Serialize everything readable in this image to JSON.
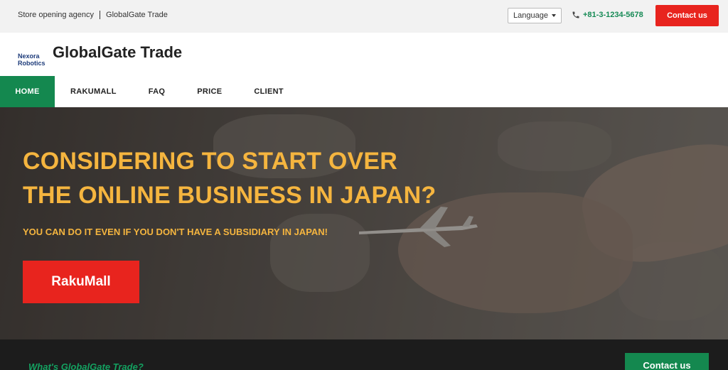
{
  "topbar": {
    "tagline_left": "Store opening agency",
    "tagline_right": "GlobalGate Trade",
    "language_label": "Language",
    "phone": "+81-3-1234-5678",
    "contact_label": "Contact us"
  },
  "header": {
    "logo_line1": "Nexora",
    "logo_line2": "Robotics",
    "brand_name": "GlobalGate Trade"
  },
  "nav": {
    "items": [
      {
        "label": "HOME",
        "active": true
      },
      {
        "label": "RAKUMALL",
        "active": false
      },
      {
        "label": "FAQ",
        "active": false
      },
      {
        "label": "PRICE",
        "active": false
      },
      {
        "label": "CLIENT",
        "active": false
      }
    ]
  },
  "hero": {
    "headline_line1": "CONSIDERING TO START OVER",
    "headline_line2": "THE ONLINE BUSINESS IN JAPAN?",
    "subheadline": "YOU CAN DO IT EVEN IF YOU DON'T HAVE A SUBSIDIARY IN JAPAN!",
    "cta_label": "RakuMall"
  },
  "section": {
    "title": "What's GlobalGate Trade?",
    "contact_label": "Contact us"
  },
  "colors": {
    "accent_green": "#14884f",
    "cta_red": "#e8241e",
    "headline_yellow": "#f5b53f",
    "phone_green": "#168a55"
  },
  "icons": {
    "phone": "phone-icon",
    "language_caret": "caret-down-icon"
  }
}
